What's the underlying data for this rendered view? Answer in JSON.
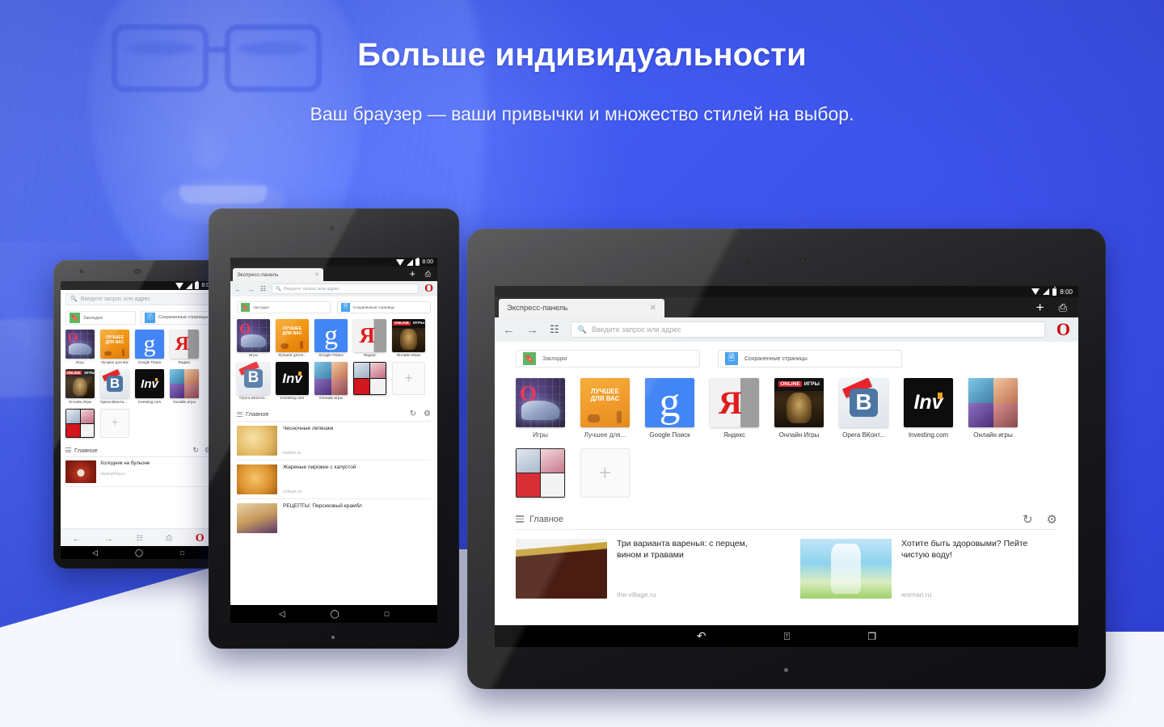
{
  "hero": {
    "headline": "Больше индивидуальности",
    "subhead": "Ваш браузер — ваши привычки и множество стилей на выбор."
  },
  "status_bar": {
    "time": "8:00"
  },
  "browser": {
    "tab_title": "Экспресс-панель",
    "close_label": "✕",
    "new_tab_label": "+",
    "address_placeholder": "Введите запрос или адрес",
    "opera_logo": "O",
    "back_icon": "←",
    "forward_icon": "→",
    "search_icon": "Q"
  },
  "shortcuts": {
    "bookmarks_label": "Закладки",
    "saved_pages_label": "Сохраненные страницы"
  },
  "speed_dial": {
    "add_label": "+",
    "tiles": [
      {
        "label": "Игры",
        "label_phone": "Игры",
        "label_mid": "Игры",
        "art": "opera",
        "art_text": "O"
      },
      {
        "label": "Лучшее для...",
        "label_phone": "Лучшее для вас",
        "label_mid": "Лучшее для в...",
        "art": "best",
        "art_text": "ЛУЧШЕЕ ДЛЯ ВАС"
      },
      {
        "label": "Google Поиск",
        "label_phone": "Google Поиск",
        "label_mid": "Google Поиск",
        "art": "google",
        "art_text": "g"
      },
      {
        "label": "Яндекс",
        "label_phone": "Яндекс",
        "label_mid": "Яндекс",
        "art": "yandex",
        "art_text": "Я"
      },
      {
        "label": "Онлайн Игры",
        "label_phone": "Онлайн Игры",
        "label_mid": "Онлайн Игры",
        "art": "games",
        "art_text": "ИГРЫ"
      },
      {
        "label": "Opera ВКонт...",
        "label_phone": "Opera ВКонтакте",
        "label_mid": "Opera ВКонта...",
        "art": "vk",
        "art_text": "В"
      },
      {
        "label": "Investing.com",
        "label_phone": "Investing.com",
        "label_mid": "Investing.com",
        "art": "inv",
        "art_text": "Inv"
      },
      {
        "label": "Онлайн игры",
        "label_phone": "Онлайн игры",
        "label_mid": "Онлайн игры",
        "art": "online",
        "art_text": ""
      },
      {
        "label": "",
        "label_phone": "",
        "label_mid": "",
        "art": "folder",
        "art_text": ""
      }
    ]
  },
  "feed": {
    "title": "Главное",
    "refresh_icon": "↻",
    "settings_icon": "⚙",
    "tablet_cards": [
      {
        "title": "Три варианта варенья: с перцем, вином и травами",
        "source": "the-village.ru",
        "img": "im-jam"
      },
      {
        "title": "Хотите быть здоровыми? Пейте чистую воду!",
        "source": "woman.ru",
        "img": "im-water"
      }
    ],
    "mid_cards": [
      {
        "title": "Чесночные лепешки",
        "source": "kedem.ru",
        "img": "im-flat"
      },
      {
        "title": "Жареные пирожки с капустой",
        "source": "ovkuse.ru",
        "img": "im-piro"
      },
      {
        "title": "РЕЦЕПТЫ: Персиковый крамбл",
        "source": "",
        "img": "im-crumble"
      }
    ],
    "phone_cards": [
      {
        "title": "Холодник на бульоне",
        "source": "vkusnyblog.ru",
        "img": "im-soup"
      }
    ]
  },
  "nav_bar": {
    "back": "back-icon",
    "home": "home-icon",
    "recents": "recents-icon"
  },
  "colors": {
    "background_blue": "#3d5cf0",
    "opera_red": "#cf0411",
    "bookmark_green": "#4caf50",
    "saved_blue": "#4aa3ee",
    "wedge_white": "#f6f7fe"
  }
}
